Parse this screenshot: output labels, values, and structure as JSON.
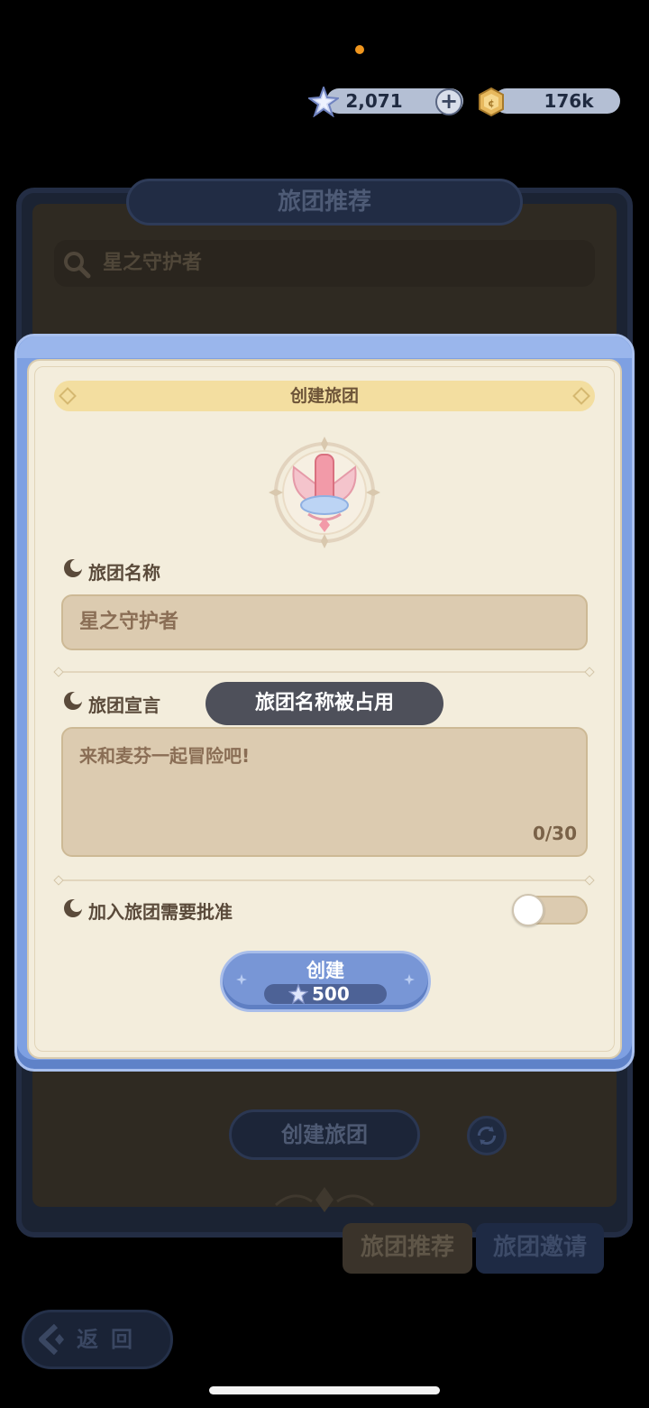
{
  "currency": {
    "gems": "2,071",
    "coins": "176k",
    "add_label": "+"
  },
  "background": {
    "panel_title": "旅团推荐",
    "search_value": "星之守护者",
    "create_button": "创建旅团",
    "tabs": [
      {
        "label": "旅团推荐",
        "active": true
      },
      {
        "label": "旅团邀请",
        "active": false
      }
    ],
    "back_label": "返回"
  },
  "modal": {
    "title": "创建旅团",
    "name_label": "旅团名称",
    "name_value": "星之守护者",
    "declaration_label": "旅团宣言",
    "declaration_value": "来和麦芬一起冒险吧!",
    "declaration_counter": "0/30",
    "approval_label": "加入旅团需要批准",
    "approval_enabled": false,
    "create_button": "创建",
    "create_cost": "500"
  },
  "toast": {
    "message": "旅团名称被占用"
  },
  "colors": {
    "accent_blue": "#7ea0e2",
    "parchment": "#f3eddc",
    "gold_band": "#f3dea0",
    "input_bg": "#dccbb0",
    "status_dot": "#f0961e"
  }
}
